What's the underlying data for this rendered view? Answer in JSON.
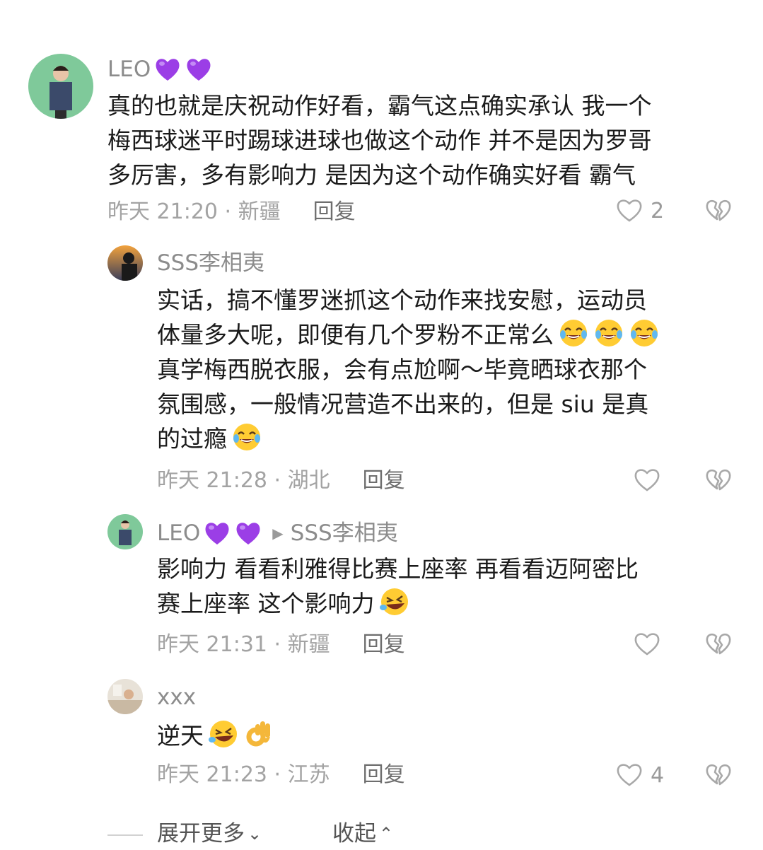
{
  "comments": [
    {
      "username": "LEO",
      "text_lines": [
        "真的也就是庆祝动作好看，霸气这点确实承认 我一个",
        "梅西球迷平时踢球进球也做这个动作 并不是因为罗哥",
        "多厉害，多有影响力 是因为这个动作确实好看 霸气"
      ],
      "time_location": "昨天 21:20 · 新疆",
      "reply_label": "回复",
      "likes": "2"
    },
    {
      "username": "SSS李相夷",
      "text_lines": [
        "实话，搞不懂罗迷抓这个动作来找安慰，运动员",
        "体量多大呢，即便有几个罗粉不正常么",
        "真学梅西脱衣服，会有点尬啊～毕竟晒球衣那个",
        "氛围感，一般情况营造不出来的，但是 siu 是真",
        "的过瘾"
      ],
      "time_location": "昨天 21:28 · 湖北",
      "reply_label": "回复",
      "likes": ""
    },
    {
      "username": "LEO",
      "reply_to": "SSS李相夷",
      "text_lines": [
        "影响力 看看利雅得比赛上座率  再看看迈阿密比",
        "赛上座率  这个影响力"
      ],
      "time_location": "昨天 21:31 · 新疆",
      "reply_label": "回复",
      "likes": ""
    },
    {
      "username": "xxx",
      "text_lines": [
        "逆天"
      ],
      "time_location": "昨天 21:23 · 江苏",
      "reply_label": "回复",
      "likes": "4"
    }
  ],
  "footer": {
    "expand_label": "展开更多",
    "collapse_label": "收起"
  },
  "colors": {
    "heart_emoji": "#9b3ee6",
    "meta_gray": "#a3a3a3",
    "name_gray": "#8c8c8c"
  }
}
